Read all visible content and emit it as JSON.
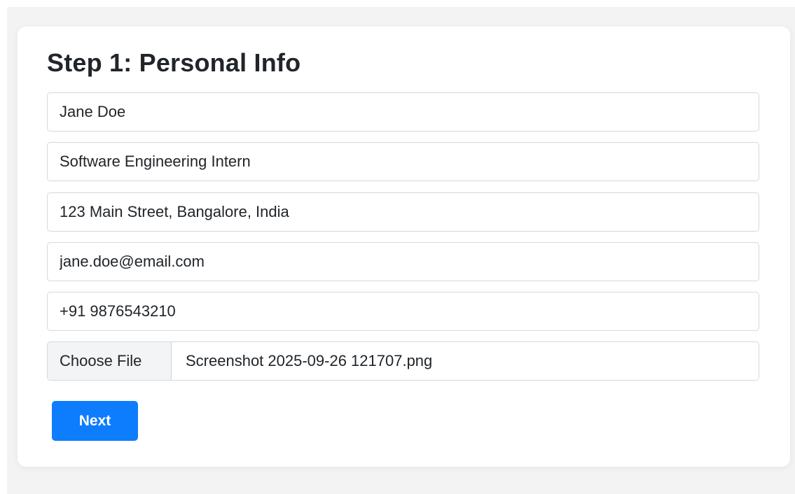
{
  "form": {
    "title": "Step 1: Personal Info",
    "fields": [
      {
        "name": "full-name",
        "value": "Jane Doe"
      },
      {
        "name": "position",
        "value": "Software Engineering Intern"
      },
      {
        "name": "address",
        "value": "123 Main Street, Bangalore, India"
      },
      {
        "name": "email",
        "value": "jane.doe@email.com"
      },
      {
        "name": "phone",
        "value": "+91 9876543210"
      }
    ],
    "file": {
      "button_label": "Choose File",
      "file_name": "Screenshot 2025-09-26 121707.png"
    },
    "next_label": "Next"
  },
  "colors": {
    "background": "#f3f3f3",
    "card": "#ffffff",
    "primary_button": "#0d7dfd",
    "text": "#212529",
    "border": "#d5d8dc"
  }
}
